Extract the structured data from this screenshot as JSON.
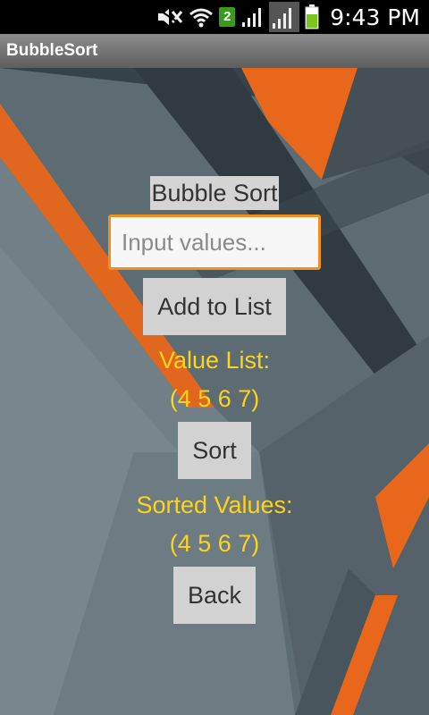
{
  "status_bar": {
    "time": "9:43 PM",
    "network_badge": "2",
    "icons": [
      "mute-icon",
      "wifi-icon",
      "network-badge-icon",
      "signal-icon",
      "signal-icon",
      "battery-icon"
    ]
  },
  "app": {
    "title": "BubbleSort"
  },
  "main": {
    "heading": "Bubble Sort",
    "input_placeholder": "Input values...",
    "add_button": "Add to List",
    "value_list_label": "Value List:",
    "value_list": "(4 5 6 7)",
    "sort_button": "Sort",
    "sorted_label": "Sorted Values:",
    "sorted_list": "(4 5 6 7)",
    "back_button": "Back"
  },
  "colors": {
    "accent": "#f0901e",
    "label_yellow": "#ffd31a",
    "button_bg": "#d2d2d2"
  }
}
